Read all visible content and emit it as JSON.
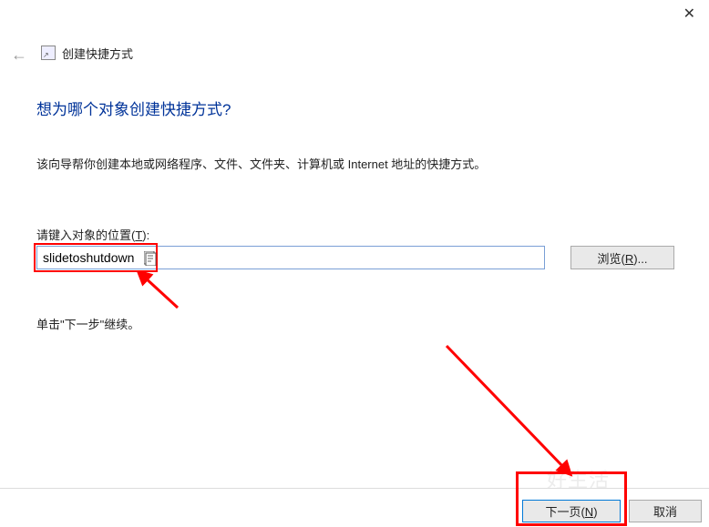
{
  "window": {
    "close": "✕"
  },
  "header": {
    "back": "←",
    "icon_glyph": "↗",
    "title": "创建快捷方式"
  },
  "main": {
    "heading": "想为哪个对象创建快捷方式?",
    "description": "该向导帮你创建本地或网络程序、文件、文件夹、计算机或 Internet 地址的快捷方式。",
    "input_label_prefix": "请键入对象的位置(",
    "input_label_hotkey": "T",
    "input_label_suffix": "):",
    "input_value": "slidetoshutdown",
    "browse_label_prefix": "浏览(",
    "browse_hotkey": "R",
    "browse_suffix": ")...",
    "continue_text": "单击\"下一步\"继续。"
  },
  "footer": {
    "next_prefix": "下一页(",
    "next_hotkey": "N",
    "next_suffix": ")",
    "cancel": "取消"
  },
  "watermark": "好生活"
}
